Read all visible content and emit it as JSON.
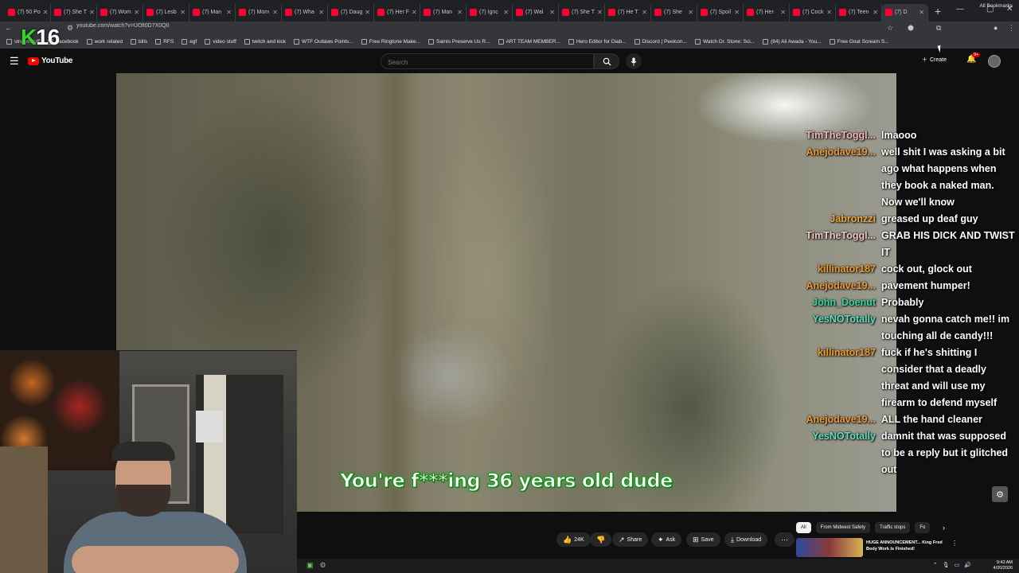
{
  "browser": {
    "tabs": [
      {
        "label": "(7) 50 Po"
      },
      {
        "label": "(7) She T"
      },
      {
        "label": "(7) Wom"
      },
      {
        "label": "(7) Lesb"
      },
      {
        "label": "(7) Man"
      },
      {
        "label": "(7) Mom"
      },
      {
        "label": "(7) Wha"
      },
      {
        "label": "(7) Daug"
      },
      {
        "label": "(7) Her F"
      },
      {
        "label": "(7) Man"
      },
      {
        "label": "(7) Ignc"
      },
      {
        "label": "(7) Wal"
      },
      {
        "label": "(7) She T"
      },
      {
        "label": "(7) He T"
      },
      {
        "label": "(7) She"
      },
      {
        "label": "(7) Spoil"
      },
      {
        "label": "(7) Her"
      },
      {
        "label": "(7) Cock"
      },
      {
        "label": "(7) Teen"
      },
      {
        "label": "(7) D"
      }
    ],
    "url": "youtube.com/watch?v=UOlt0D7X0Q0",
    "bookmarks": [
      "streamstuff",
      "Facebook",
      "work related",
      "bills",
      "RFS",
      "egf",
      "video stuff",
      "twitch and kick",
      "WTF Outlaws Points...",
      "Free Ringtone Make...",
      "Saints Preserve Us R...",
      "ART TEAM MEMBER...",
      "Hero Editor for Diab...",
      "Discord | Peelcon...",
      "Watch Dr. Stone: Sci...",
      "(84) Ali Awada - You...",
      "Free Goat Scream S..."
    ],
    "all_bookmarks": "All Bookmarks"
  },
  "overlay_logo": {
    "k": "K",
    "num": "16"
  },
  "youtube": {
    "brand": "YouTube",
    "search_placeholder": "Search",
    "create_label": "Create",
    "notif_count": "9+"
  },
  "player": {
    "subtitle": "You're f***ing 36 years old dude"
  },
  "chat": [
    {
      "user": "TimTheToggl...",
      "color": "#f4b7b7",
      "msg": "lmaooo"
    },
    {
      "user": "Anejodave19...",
      "color": "#ef9a3a",
      "msg": "well shit I was asking a bit ago what happens when they book a naked man. Now we'll know"
    },
    {
      "user": "Jabronzzi",
      "color": "#f0a83c",
      "msg": "greased up deaf guy"
    },
    {
      "user": "TimTheToggl...",
      "color": "#f4c7c7",
      "msg": "GRAB HIS DICK AND TWIST IT"
    },
    {
      "user": "killinator187",
      "color": "#f09a2a",
      "msg": "cock out, glock out"
    },
    {
      "user": "Anejodave19...",
      "color": "#ef9a3a",
      "msg": "pavement humper!"
    },
    {
      "user": "John_Doenut",
      "color": "#3bd6a0",
      "msg": "Probably"
    },
    {
      "user": "YesNOTotally",
      "color": "#5ee0c0",
      "msg": "nevah gonna catch me!! im touching all de candy!!!"
    },
    {
      "user": "killinator187",
      "color": "#f09a2a",
      "msg": "fuck if he's shitting I consider that a deadly threat and will use my firearm to defend myself"
    },
    {
      "user": "Anejodave19...",
      "color": "#ef9a3a",
      "msg": "ALL the hand cleaner"
    },
    {
      "user": "YesNOTotally",
      "color": "#5ee0c0",
      "msg": "damnit that was supposed to be a reply but it glitched out"
    }
  ],
  "actions": {
    "likes": "24K",
    "share": "Share",
    "ask": "Ask",
    "save": "Save",
    "download": "Download"
  },
  "chips": [
    "All",
    "From Midwest Safety",
    "Traffic stops",
    "Fo"
  ],
  "recommended": {
    "title": "HUGE ANNOUNCEMENT... King Fred Body Work Is Finished!"
  },
  "taskbar": {
    "time": "9:43 AM",
    "date": "4/20/2026"
  }
}
